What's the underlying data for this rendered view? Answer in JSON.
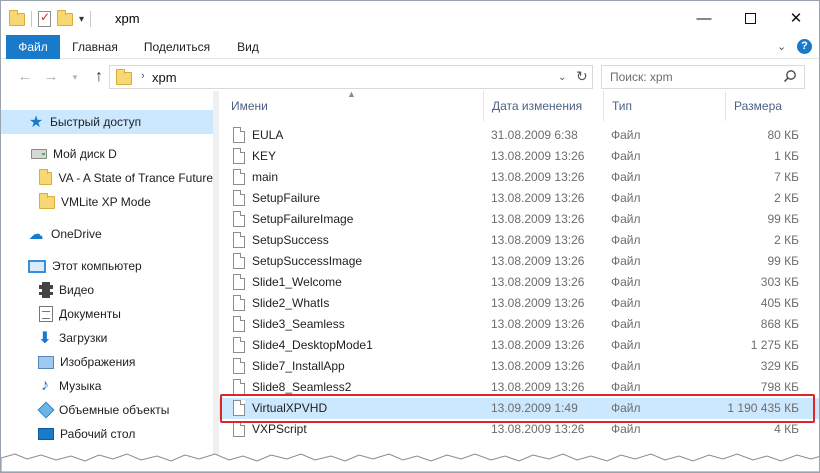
{
  "window": {
    "title": "xpm",
    "minimize_glyph": "—",
    "close_glyph": "✕"
  },
  "ribbon": {
    "tabs": [
      {
        "label": "Файл",
        "active": true
      },
      {
        "label": "Главная"
      },
      {
        "label": "Поделиться"
      },
      {
        "label": "Вид"
      }
    ],
    "help_glyph": "?"
  },
  "address": {
    "path": "xpm",
    "search_placeholder": "Поиск: xpm"
  },
  "nav": {
    "items": [
      {
        "label": "Быстрый доступ",
        "icon": "star-icon",
        "selected": true
      },
      {
        "label": "Мой диск D",
        "icon": "drive-icon"
      },
      {
        "label": "VA - A State of Trance Future",
        "icon": "folder-icon"
      },
      {
        "label": "VMLite XP Mode",
        "icon": "folder-icon"
      },
      {
        "label": "OneDrive",
        "icon": "cloud-icon"
      },
      {
        "label": "Этот компьютер",
        "icon": "computer-icon"
      },
      {
        "label": "Видео",
        "icon": "video-icon"
      },
      {
        "label": "Документы",
        "icon": "documents-icon"
      },
      {
        "label": "Загрузки",
        "icon": "download-icon"
      },
      {
        "label": "Изображения",
        "icon": "pictures-icon"
      },
      {
        "label": "Музыка",
        "icon": "music-icon"
      },
      {
        "label": "Объемные объекты",
        "icon": "3d-objects-icon"
      },
      {
        "label": "Рабочий стол",
        "icon": "desktop-icon"
      }
    ]
  },
  "columns": {
    "name": "Имени",
    "date": "Дата изменения",
    "type": "Тип",
    "size": "Размера"
  },
  "files": [
    {
      "name": "EULA",
      "date": "31.08.2009 6:38",
      "type": "Файл",
      "size": "80 КБ"
    },
    {
      "name": "KEY",
      "date": "13.08.2009 13:26",
      "type": "Файл",
      "size": "1 КБ"
    },
    {
      "name": "main",
      "date": "13.08.2009 13:26",
      "type": "Файл",
      "size": "7 КБ"
    },
    {
      "name": "SetupFailure",
      "date": "13.08.2009 13:26",
      "type": "Файл",
      "size": "2 КБ"
    },
    {
      "name": "SetupFailureImage",
      "date": "13.08.2009 13:26",
      "type": "Файл",
      "size": "99 КБ"
    },
    {
      "name": "SetupSuccess",
      "date": "13.08.2009 13:26",
      "type": "Файл",
      "size": "2 КБ"
    },
    {
      "name": "SetupSuccessImage",
      "date": "13.08.2009 13:26",
      "type": "Файл",
      "size": "99 КБ"
    },
    {
      "name": "Slide1_Welcome",
      "date": "13.08.2009 13:26",
      "type": "Файл",
      "size": "303 КБ"
    },
    {
      "name": "Slide2_WhatIs",
      "date": "13.08.2009 13:26",
      "type": "Файл",
      "size": "405 КБ"
    },
    {
      "name": "Slide3_Seamless",
      "date": "13.08.2009 13:26",
      "type": "Файл",
      "size": "868 КБ"
    },
    {
      "name": "Slide4_DesktopMode1",
      "date": "13.08.2009 13:26",
      "type": "Файл",
      "size": "1 275 КБ"
    },
    {
      "name": "Slide7_InstallApp",
      "date": "13.08.2009 13:26",
      "type": "Файл",
      "size": "329 КБ"
    },
    {
      "name": "Slide8_Seamless2",
      "date": "13.08.2009 13:26",
      "type": "Файл",
      "size": "798 КБ"
    },
    {
      "name": "VirtualXPVHD",
      "date": "13.09.2009 1:49",
      "type": "Файл",
      "size": "1 190 435 КБ",
      "highlighted": true
    },
    {
      "name": "VXPScript",
      "date": "13.08.2009 13:26",
      "type": "Файл",
      "size": "4 КБ"
    }
  ],
  "colors": {
    "accent": "#1979ca",
    "selection": "#cce8ff",
    "highlight_border": "#e0242b"
  }
}
